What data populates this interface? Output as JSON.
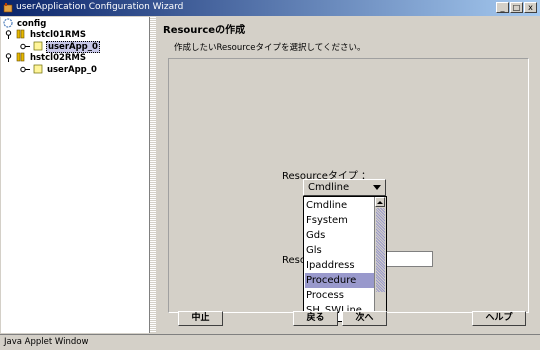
{
  "window": {
    "title": "userApplication Configuration Wizard",
    "min": "_",
    "max": "□",
    "close": "x"
  },
  "tree": {
    "root": "config",
    "nodes": [
      {
        "label": "hstcl01RMS",
        "children": [
          {
            "label": "userApp_0",
            "selected": true
          }
        ]
      },
      {
        "label": "hstcl02RMS",
        "children": [
          {
            "label": "userApp_0",
            "selected": false
          }
        ]
      }
    ]
  },
  "main": {
    "title": "Resourceの作成",
    "subtitle": "作成したいResourceタイプを選択してください。",
    "resource_type_label": "Resourceタイプ ：",
    "resource_type_value": "Cmdline",
    "resource_name_label": "Reso",
    "dropdown_options": [
      "Cmdline",
      "Fsystem",
      "Gds",
      "Gls",
      "Ipaddress",
      "Procedure",
      "Process",
      "SH_SWLine"
    ],
    "highlighted_option": "Procedure"
  },
  "buttons": {
    "cancel": "中止",
    "back": "戻る",
    "next": "次へ",
    "help": "ヘルプ"
  },
  "status": {
    "text": "Java Applet Window"
  }
}
